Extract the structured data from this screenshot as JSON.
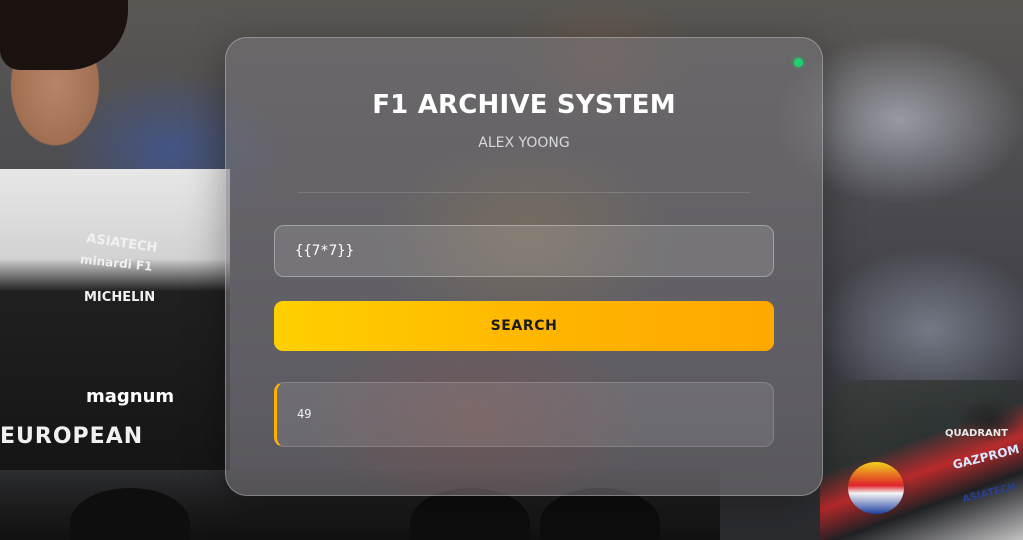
{
  "app": {
    "title": "F1 ARCHIVE SYSTEM",
    "subtitle": "ALEX YOONG",
    "status": "online",
    "status_color": "#1fd06e"
  },
  "search": {
    "value": "{{7*7}}",
    "button_label": "SEARCH",
    "button_color": "#ffc400"
  },
  "result": {
    "text": "49",
    "accent_color": "#ffb300"
  },
  "background": {
    "sponsor_texts": [
      "ASIATECH",
      "minardi F1",
      "MICHELIN",
      "magnum",
      "EUROPEAN",
      "QUADRANT",
      "ASIATECH",
      "GAZPROM"
    ]
  }
}
